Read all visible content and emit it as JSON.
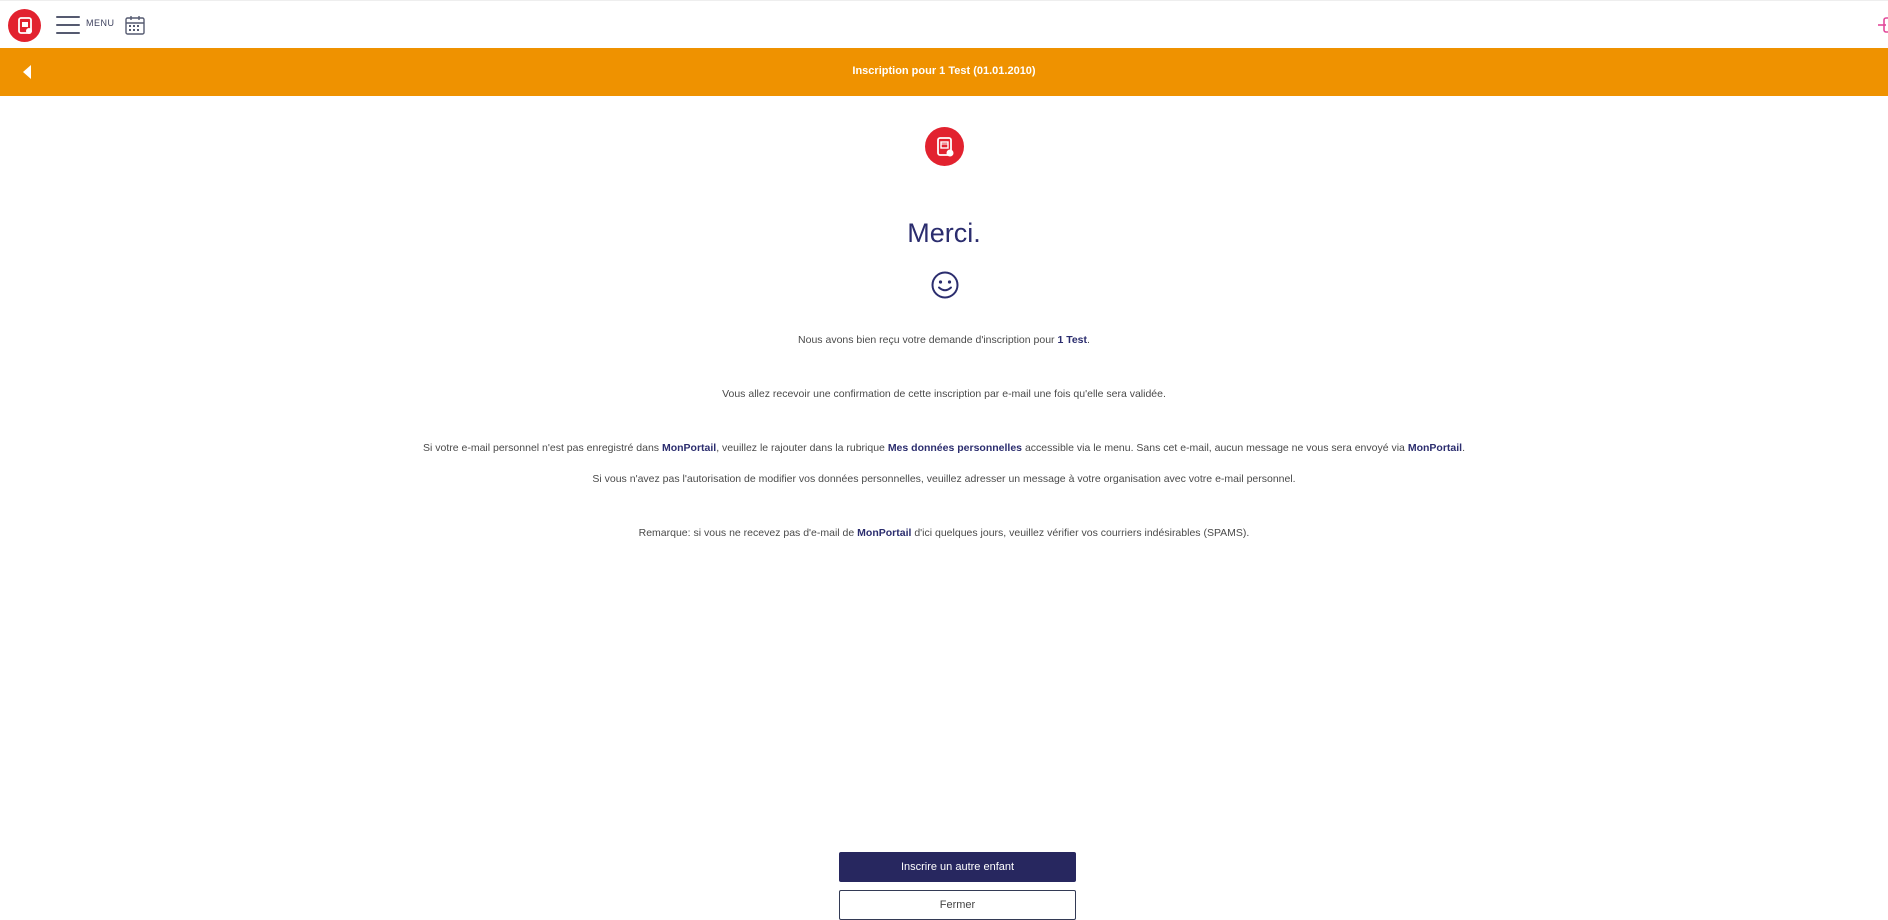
{
  "topbar": {
    "menu_label": "MENU",
    "logo_icon": "app-logo-icon",
    "menu_icon": "hamburger-icon",
    "calendar_icon": "calendar-icon"
  },
  "header": {
    "title": "Inscription pour 1 Test (01.01.2010)",
    "back_icon": "back-arrow-icon",
    "background": "#ef9200"
  },
  "main": {
    "heading": "Merci.",
    "hero_icon": "tablet-touch-icon",
    "smiley_icon": "smiley-icon",
    "line1": {
      "before": "Nous avons bien reçu votre demande d'inscription pour ",
      "bold": "1 Test",
      "after": "."
    },
    "line2": "Vous allez recevoir une confirmation de cette inscription par e-mail une fois qu'elle sera validée.",
    "line3": {
      "part1": "Si votre e-mail personnel n'est pas enregistré dans ",
      "bold1": "MonPortail",
      "part2": ", veuillez le rajouter dans la rubrique ",
      "bold2": "Mes données personnelles",
      "part3": " accessible via le menu. Sans cet e-mail, aucun message ne vous sera envoyé via ",
      "bold3": "MonPortail",
      "part4": "."
    },
    "line4": "Si vous n'avez pas l'autorisation de modifier vos données personnelles, veuillez adresser un message à votre organisation avec votre e-mail personnel.",
    "line5": {
      "before": "Remarque: si vous ne recevez pas d'e-mail de ",
      "bold": "MonPortail",
      "after": " d'ici quelques jours, veuillez vérifier vos courriers indésirables (SPAMS)."
    }
  },
  "actions": {
    "primary_label": "Inscrire un autre enfant",
    "secondary_label": "Fermer"
  },
  "colors": {
    "accent": "#ef9200",
    "brand_red": "#e2222f",
    "navy": "#27275f"
  }
}
